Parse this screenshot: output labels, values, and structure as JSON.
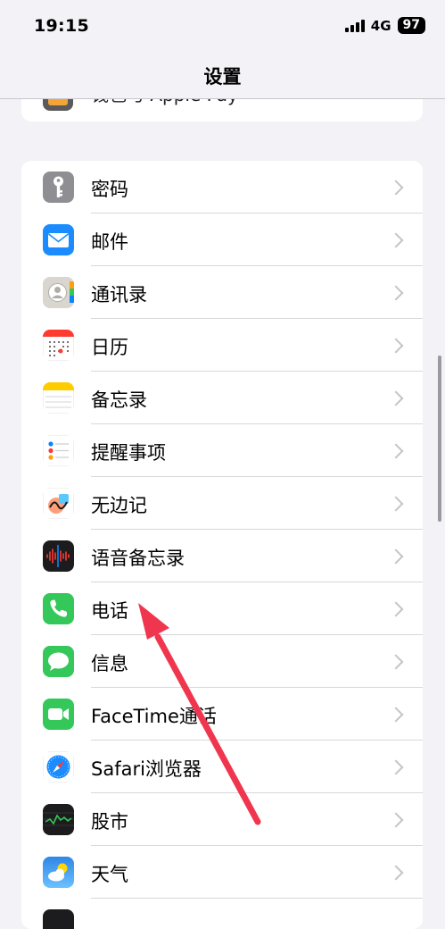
{
  "status": {
    "time": "19:15",
    "network": "4G",
    "battery": "97"
  },
  "nav": {
    "title": "设置"
  },
  "top_group": {
    "partial_label": "钱包与 Apple Pay"
  },
  "items": [
    {
      "label": "密码",
      "icon": "key-icon"
    },
    {
      "label": "邮件",
      "icon": "mail-icon"
    },
    {
      "label": "通讯录",
      "icon": "contacts-icon"
    },
    {
      "label": "日历",
      "icon": "calendar-icon"
    },
    {
      "label": "备忘录",
      "icon": "notes-icon"
    },
    {
      "label": "提醒事项",
      "icon": "reminders-icon"
    },
    {
      "label": "无边记",
      "icon": "freeform-icon"
    },
    {
      "label": "语音备忘录",
      "icon": "voice-memos-icon"
    },
    {
      "label": "电话",
      "icon": "phone-icon"
    },
    {
      "label": "信息",
      "icon": "messages-icon"
    },
    {
      "label": "FaceTime通话",
      "icon": "facetime-icon"
    },
    {
      "label": "Safari浏览器",
      "icon": "safari-icon"
    },
    {
      "label": "股市",
      "icon": "stocks-icon"
    },
    {
      "label": "天气",
      "icon": "weather-icon"
    }
  ],
  "annotation": {
    "color": "#f0364f"
  }
}
